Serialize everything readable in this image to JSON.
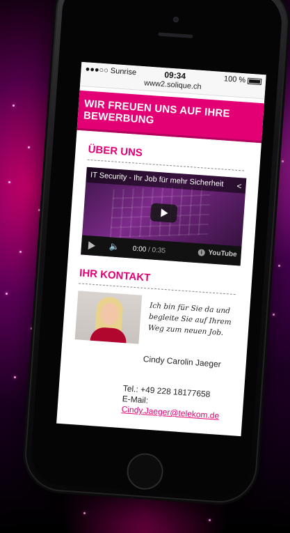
{
  "status_bar": {
    "carrier": "●●●○○ Sunrise",
    "time": "09:34",
    "battery": "100 %",
    "url": "www2.solique.ch"
  },
  "banner": {
    "text": "WIR FREUEN UNS AUF IHRE BEWERBUNG"
  },
  "about": {
    "title": "ÜBER UNS",
    "video": {
      "title": "IT Security - Ihr Job für mehr Sicherheit",
      "current_time": "0:00",
      "duration": "/ 0:35",
      "brand": "YouTube"
    }
  },
  "contact": {
    "title": "IHR KONTAKT",
    "quote": "Ich bin für Sie da und begleite Sie auf Ihrem Weg zum neuen Job.",
    "name": "Cindy Carolin Jaeger",
    "phone": "Tel.: +49 228 18177658",
    "email_label": "E-Mail:",
    "email": "Cindy.Jaeger@telekom.de"
  },
  "colors": {
    "accent": "#e20074",
    "phone_body": "#0b0b0c"
  }
}
